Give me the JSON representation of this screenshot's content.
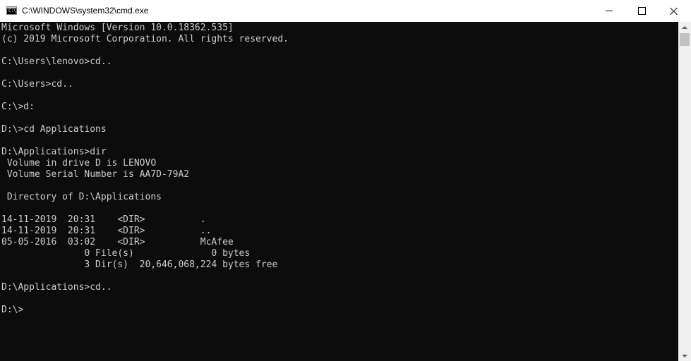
{
  "window": {
    "title": "C:\\WINDOWS\\system32\\cmd.exe",
    "icon": "cmd-prompt-icon",
    "icon_label": "C:\\",
    "controls": {
      "minimize": "minimize-icon",
      "maximize": "maximize-icon",
      "close": "close-icon"
    }
  },
  "console": {
    "text_color": "#cccccc",
    "background": "#0c0c0c",
    "lines": [
      "Microsoft Windows [Version 10.0.18362.535]",
      "(c) 2019 Microsoft Corporation. All rights reserved.",
      "",
      "C:\\Users\\lenovo>cd..",
      "",
      "C:\\Users>cd..",
      "",
      "C:\\>d:",
      "",
      "D:\\>cd Applications",
      "",
      "D:\\Applications>dir",
      " Volume in drive D is LENOVO",
      " Volume Serial Number is AA7D-79A2",
      "",
      " Directory of D:\\Applications",
      "",
      "14-11-2019  20:31    <DIR>          .",
      "14-11-2019  20:31    <DIR>          ..",
      "05-05-2016  03:02    <DIR>          McAfee",
      "               0 File(s)              0 bytes",
      "               3 Dir(s)  20,646,068,224 bytes free",
      "",
      "D:\\Applications>cd..",
      "",
      "D:\\>"
    ]
  },
  "scrollbar": {
    "up": "scroll-up-arrow-icon",
    "down": "scroll-down-arrow-icon"
  }
}
